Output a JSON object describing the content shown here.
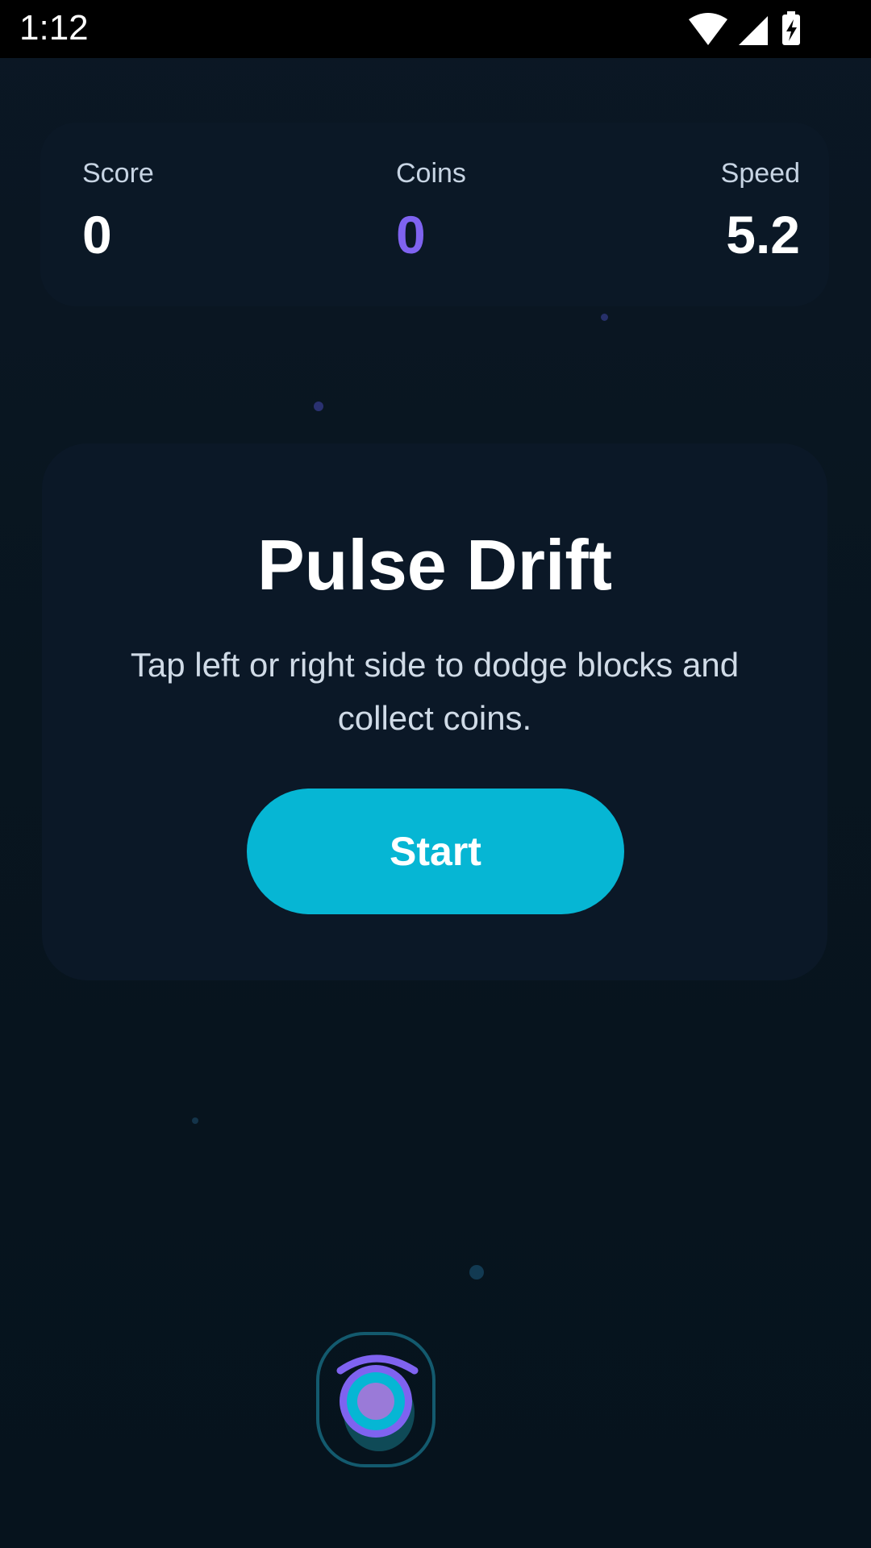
{
  "status_bar": {
    "time": "1:12",
    "icons": [
      "wifi-icon",
      "signal-icon",
      "battery-charging-icon"
    ]
  },
  "hud": {
    "score_label": "Score",
    "score_value": "0",
    "coins_label": "Coins",
    "coins_value": "0",
    "speed_label": "Speed",
    "speed_value": "5.2"
  },
  "menu": {
    "title": "Pulse Drift",
    "subtitle": "Tap left or right side to dodge blocks and collect coins.",
    "start_label": "Start"
  },
  "player": {
    "icon": "player-orb-icon"
  },
  "colors": {
    "background": "#07141f",
    "card": "#0b1827",
    "accent": "#06b6d4",
    "coins": "#7f63f0",
    "text_primary": "#ffffff",
    "text_secondary": "#c7d4e3"
  }
}
